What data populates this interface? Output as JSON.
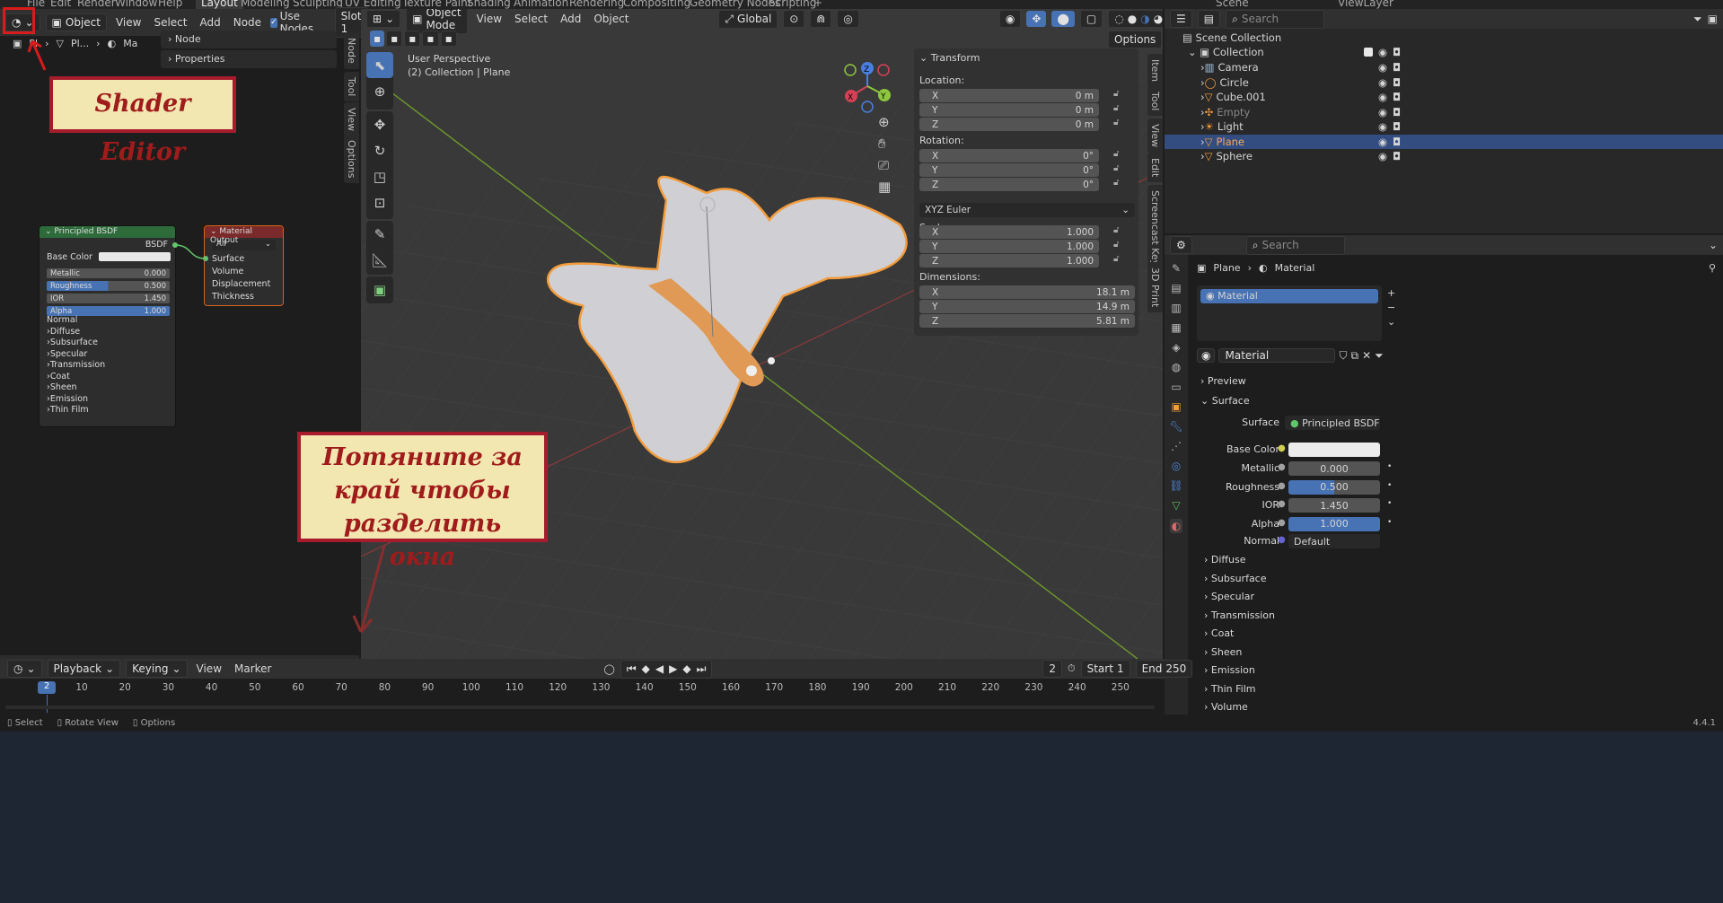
{
  "topbar": {
    "tabs": [
      "File",
      "Edit",
      "Render",
      "Window",
      "Help",
      "Layout",
      "Modeling",
      "Sculpting",
      "UV Editing",
      "Texture Paint",
      "Shading",
      "Animation",
      "Rendering",
      "Compositing",
      "Geometry Nodes",
      "Scripting"
    ],
    "scene": "Scene",
    "viewlayer": "ViewLayer"
  },
  "shader": {
    "editor_label": "Object",
    "menus": [
      "View",
      "Select",
      "Add",
      "Node"
    ],
    "use_nodes": "Use Nodes",
    "slot": "Slot 1",
    "breadcrumb": [
      "Pl",
      "Pl...",
      "Ma"
    ],
    "sidebar_node": "Node",
    "sidebar_properties": "Properties",
    "vtabs": [
      "Node",
      "Tool",
      "View",
      "Options"
    ]
  },
  "bsdf": {
    "title": "Principled BSDF",
    "out": "BSDF",
    "base_color": "Base Color",
    "fields": [
      {
        "label": "Metallic",
        "value": "0.000",
        "fill": 0
      },
      {
        "label": "Roughness",
        "value": "0.500",
        "fill": 0.5
      },
      {
        "label": "IOR",
        "value": "1.450",
        "fill": 0
      },
      {
        "label": "Alpha",
        "value": "1.000",
        "fill": 1
      }
    ],
    "normal": "Normal",
    "subpanels": [
      "Diffuse",
      "Subsurface",
      "Specular",
      "Transmission",
      "Coat",
      "Sheen",
      "Emission",
      "Thin Film"
    ]
  },
  "matout": {
    "title": "Material Output",
    "target": "All",
    "inputs": [
      "Surface",
      "Volume",
      "Displacement",
      "Thickness"
    ]
  },
  "viewport": {
    "mode": "Object Mode",
    "menus": [
      "View",
      "Select",
      "Add",
      "Object"
    ],
    "orientation": "Global",
    "options": "Options",
    "perspective": "User Perspective",
    "collection": "(2) Collection | Plane",
    "vtabs": [
      "Item",
      "Tool",
      "View",
      "Edit",
      "Screencast Keys",
      "3D Print"
    ]
  },
  "transform": {
    "title": "Transform",
    "location_label": "Location:",
    "location": [
      {
        "axis": "X",
        "v": "0 m"
      },
      {
        "axis": "Y",
        "v": "0 m"
      },
      {
        "axis": "Z",
        "v": "0 m"
      }
    ],
    "rotation_label": "Rotation:",
    "rotation": [
      {
        "axis": "X",
        "v": "0°"
      },
      {
        "axis": "Y",
        "v": "0°"
      },
      {
        "axis": "Z",
        "v": "0°"
      }
    ],
    "euler": "XYZ Euler",
    "scale_label": "Scale:",
    "scale": [
      {
        "axis": "X",
        "v": "1.000"
      },
      {
        "axis": "Y",
        "v": "1.000"
      },
      {
        "axis": "Z",
        "v": "1.000"
      }
    ],
    "dimensions_label": "Dimensions:",
    "dimensions": [
      {
        "axis": "X",
        "v": "18.1 m"
      },
      {
        "axis": "Y",
        "v": "14.9 m"
      },
      {
        "axis": "Z",
        "v": "5.81 m"
      }
    ]
  },
  "outliner": {
    "search": "Search",
    "root": "Scene Collection",
    "collection": "Collection",
    "items": [
      "Camera",
      "Circle",
      "Cube.001",
      "Empty",
      "Light",
      "Plane",
      "Sphere"
    ],
    "selected": "Plane"
  },
  "properties": {
    "search": "Search",
    "breadcrumb": [
      "Plane",
      "Material"
    ],
    "slot": "Material",
    "material_name": "Material",
    "preview": "Preview",
    "surface_section": "Surface",
    "surface_label": "Surface",
    "surface_value": "Principled BSDF",
    "base_color": "Base Color",
    "fields": [
      {
        "label": "Metallic",
        "value": "0.000",
        "fill": 0
      },
      {
        "label": "Roughness",
        "value": "0.500",
        "fill": 0.5
      },
      {
        "label": "IOR",
        "value": "1.450",
        "fill": 0
      },
      {
        "label": "Alpha",
        "value": "1.000",
        "fill": 1
      }
    ],
    "normal_label": "Normal",
    "normal_value": "Default",
    "subpanels": [
      "Diffuse",
      "Subsurface",
      "Specular",
      "Transmission",
      "Coat",
      "Sheen",
      "Emission",
      "Thin Film",
      "Volume"
    ]
  },
  "timeline": {
    "menus": [
      "Playback",
      "Keying",
      "View",
      "Marker"
    ],
    "current_frame": "2",
    "start_label": "Start",
    "start": "1",
    "end_label": "End",
    "end": "250",
    "ticks": [
      "10",
      "20",
      "30",
      "40",
      "50",
      "60",
      "70",
      "80",
      "90",
      "100",
      "110",
      "120",
      "130",
      "140",
      "150",
      "160",
      "170",
      "180",
      "190",
      "200",
      "210",
      "220",
      "230",
      "240",
      "250"
    ],
    "playhead": "2"
  },
  "status": {
    "select": "Select",
    "rotate": "Rotate View",
    "options": "Options",
    "version": "4.4.1"
  },
  "callouts": {
    "shader_editor": "Shader Editor",
    "split_hint": "Потяните за край чтобы разделить окна"
  },
  "colors": {
    "accent": "#4772b3",
    "selection_outline": "#f39c3c",
    "annotation_red": "#d81b1b",
    "callout_bg": "#f3e7b1"
  }
}
